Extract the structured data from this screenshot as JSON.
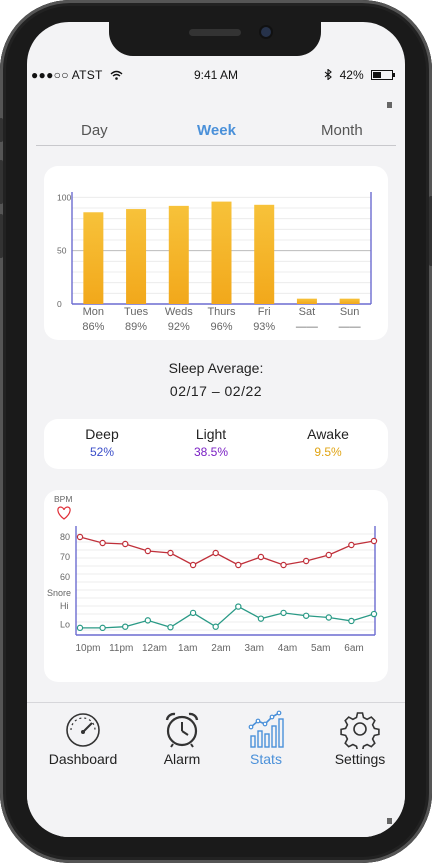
{
  "status_bar": {
    "carrier": "●●●○○ ATST",
    "time": "9:41 AM",
    "battery": "42%",
    "battery_level": 0.42
  },
  "range_tabs": [
    {
      "label": "Day",
      "active": false
    },
    {
      "label": "Week",
      "active": true
    },
    {
      "label": "Month",
      "active": false
    }
  ],
  "chart_data": [
    {
      "type": "bar",
      "categories": [
        "Mon",
        "Tues",
        "Weds",
        "Thurs",
        "Fri",
        "Sat",
        "Sun"
      ],
      "values": [
        86,
        89,
        92,
        96,
        93,
        5,
        5
      ],
      "value_labels": [
        "86%",
        "89%",
        "92%",
        "96%",
        "93%",
        "——",
        "——"
      ],
      "yticks": [
        0,
        50,
        100
      ],
      "ylim": [
        0,
        105
      ],
      "bar_color_top": "#f7c23a",
      "bar_color_bottom": "#f2a81b",
      "axis_color": "#6b6bd0",
      "grid": true
    },
    {
      "type": "line",
      "y_title": "BPM",
      "x": [
        "10pm",
        "11pm",
        "12am",
        "1am",
        "2am",
        "3am",
        "4am",
        "5am",
        "6am"
      ],
      "y_tick_labels": [
        "80",
        "70",
        "60",
        "Snore",
        "Hi",
        "Lo"
      ],
      "series": [
        {
          "name": "BPM",
          "color": "#c0303a",
          "values": [
            80,
            77,
            76.5,
            73,
            72,
            66,
            72,
            66,
            70,
            66,
            68,
            71,
            76,
            78
          ]
        },
        {
          "name": "Snore",
          "color": "#2a9a86",
          "values": [
            0.1,
            0.1,
            0.2,
            0.75,
            0.15,
            1.4,
            0.2,
            1.95,
            0.9,
            1.4,
            1.15,
            1.0,
            0.7,
            1.3
          ]
        }
      ],
      "axis_color": "#6b6bd0",
      "grid": true
    }
  ],
  "sleep_average": {
    "title": "Sleep Average:",
    "range": "02/17 – 02/22"
  },
  "stages": [
    {
      "label": "Deep",
      "value": "52%",
      "color": "#3b4ec9"
    },
    {
      "label": "Light",
      "value": "38.5%",
      "color": "#7a1fc4"
    },
    {
      "label": "Awake",
      "value": "9.5%",
      "color": "#e0a414"
    }
  ],
  "tab_bar": [
    {
      "label": "Dashboard",
      "icon": "speedometer-icon",
      "active": false
    },
    {
      "label": "Alarm",
      "icon": "alarm-clock-icon",
      "active": false
    },
    {
      "label": "Stats",
      "icon": "stats-chart-icon",
      "active": true
    },
    {
      "label": "Settings",
      "icon": "gear-icon",
      "active": false
    }
  ],
  "colors": {
    "accent": "#4a90d9",
    "background": "#f3f3f5",
    "card": "#ffffff",
    "heart": "#e0303a"
  }
}
